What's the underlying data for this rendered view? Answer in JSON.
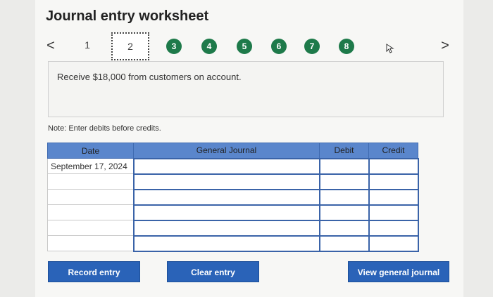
{
  "header": {
    "title": "Journal entry worksheet"
  },
  "steps": {
    "prev_symbol": "<",
    "next_symbol": ">",
    "plain": "1",
    "current": "2",
    "circles": [
      "3",
      "4",
      "5",
      "6",
      "7",
      "8"
    ],
    "circle_color": "#1e7a4a"
  },
  "prompt": {
    "text": "Receive $18,000 from customers on account."
  },
  "note": "Note: Enter debits before credits.",
  "table": {
    "headers": {
      "date": "Date",
      "general_journal": "General Journal",
      "debit": "Debit",
      "credit": "Credit"
    },
    "rows": [
      {
        "date": "September 17, 2024",
        "account": "",
        "debit": "",
        "credit": ""
      },
      {
        "date": "",
        "account": "",
        "debit": "",
        "credit": ""
      },
      {
        "date": "",
        "account": "",
        "debit": "",
        "credit": ""
      },
      {
        "date": "",
        "account": "",
        "debit": "",
        "credit": ""
      },
      {
        "date": "",
        "account": "",
        "debit": "",
        "credit": ""
      },
      {
        "date": "",
        "account": "",
        "debit": "",
        "credit": ""
      }
    ],
    "header_color": "#5a86cc"
  },
  "buttons": {
    "record": "Record entry",
    "clear": "Clear entry",
    "view": "View general journal",
    "color": "#2a63b8"
  }
}
